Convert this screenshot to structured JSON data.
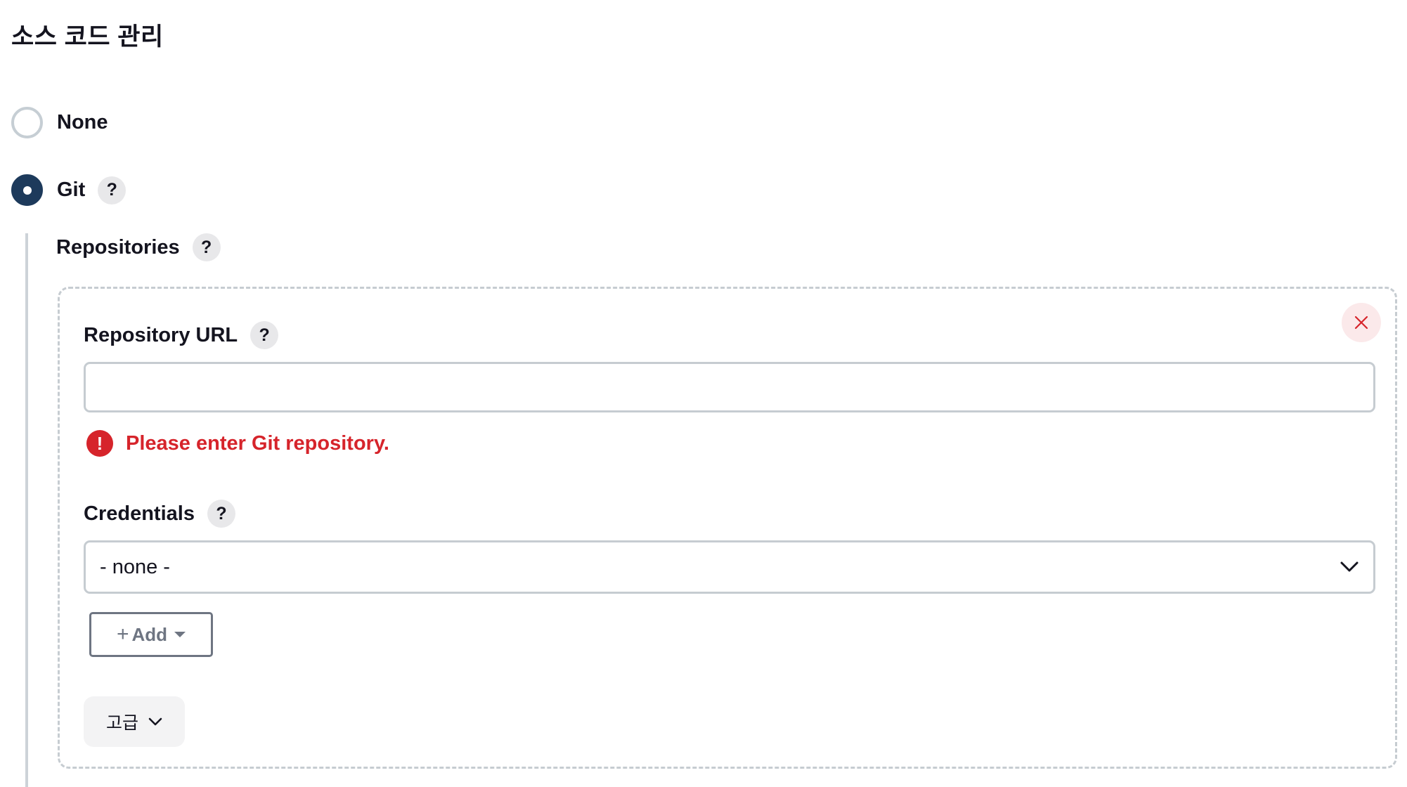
{
  "section": {
    "title": "소스 코드 관리"
  },
  "scm_options": [
    {
      "label": "None",
      "selected": false
    },
    {
      "label": "Git",
      "selected": true,
      "help": "?"
    }
  ],
  "repositories": {
    "label": "Repositories",
    "help": "?",
    "repository_url": {
      "label": "Repository URL",
      "help": "?",
      "value": "",
      "error_icon": "!",
      "error": "Please enter Git repository."
    },
    "credentials": {
      "label": "Credentials",
      "help": "?",
      "selected": "- none -"
    },
    "add_button": {
      "plus": "+",
      "label": "Add"
    },
    "advanced_button": {
      "label": "고급"
    }
  },
  "colors": {
    "radio_checked": "#1d3a5b",
    "error": "#d6242b",
    "close_bg": "#fbe9ea"
  }
}
